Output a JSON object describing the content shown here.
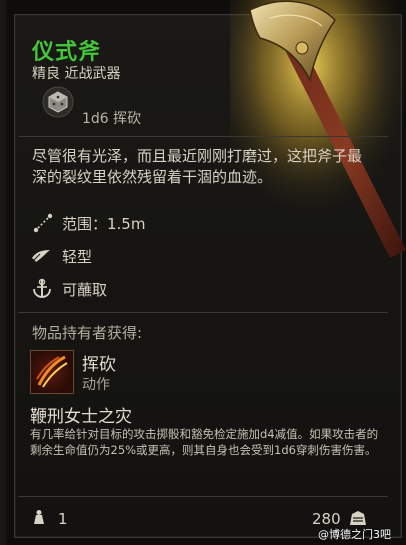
{
  "item": {
    "name": "仪式斧",
    "subtitle": "精良 近战武器",
    "damage": "1d6 挥砍",
    "description": "尽管很有光泽，而且最近刚刚打磨过，这把斧子最深的裂纹里依然残留着干涸的血迹。",
    "properties": [
      {
        "icon": "range-icon",
        "label": "范围：1.5m"
      },
      {
        "icon": "light-weapon-icon",
        "label": "轻型"
      },
      {
        "icon": "dippable-icon",
        "label": "可蘸取"
      }
    ]
  },
  "holder_section": {
    "heading": "物品持有者获得:",
    "ability": {
      "icon": "slash-icon",
      "name": "挥砍",
      "type": "动作"
    },
    "curse": {
      "title": "鞭刑女士之灾",
      "text": "有几率给针对目标的攻击掷骰和豁免检定施加d4减值。如果攻击者的剩余生命值仍为25%或更高，则其自身也会受到1d6穿刺伤害伤害。"
    }
  },
  "footer": {
    "weight": "1",
    "price": "280"
  },
  "watermark": "@博德之门3吧",
  "colors": {
    "name": "#43c63a",
    "panel": "#161512",
    "border": "#3a3731"
  }
}
